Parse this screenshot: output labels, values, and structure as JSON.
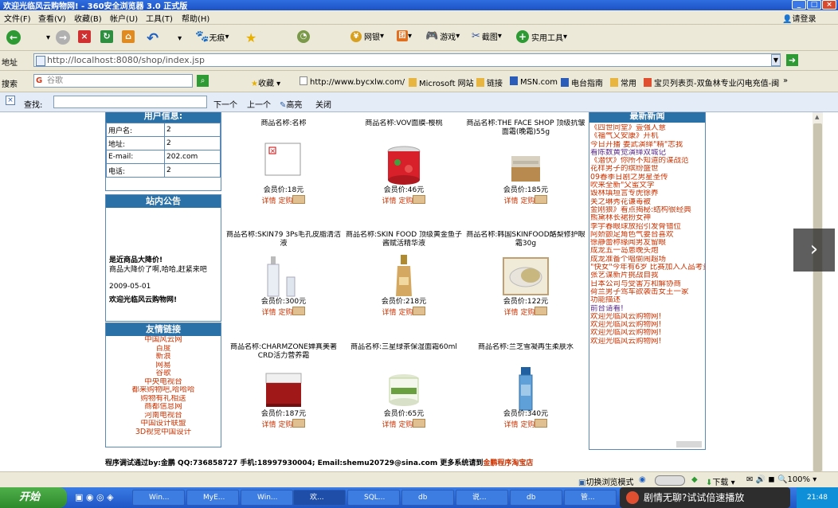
{
  "window": {
    "title": "欢迎光临风云购物网! - 360安全浏览器 3.0 正式版"
  },
  "menu": [
    "文件(F)",
    "查看(V)",
    "收藏(B)",
    "帐户(U)",
    "工具(T)",
    "帮助(H)"
  ],
  "login_label": "请登录",
  "toolbar": {
    "noimage_label": "无痕",
    "netbank_label": "网银",
    "group_label": "团",
    "game_label": "游戏",
    "screenshot_label": "截图",
    "tools_label": "实用工具"
  },
  "address": {
    "label": "地址",
    "url": "http://localhost:8080/shop/index.jsp"
  },
  "search": {
    "label": "搜索",
    "placeholder": "谷歌"
  },
  "favorites": {
    "fav_label": "收藏",
    "items": [
      "http://www.bycxlw.com/",
      "Microsoft 网站",
      "链接",
      "MSN.com",
      "电台指南",
      "常用",
      "宝贝列表页-双鱼林专业闪电充值-闽"
    ]
  },
  "findbar": {
    "label": "查找:",
    "next": "下一个",
    "prev": "上一个",
    "highlight": "高亮",
    "close": "关闭"
  },
  "user_info": {
    "title": "用户信息:",
    "rows": [
      {
        "label": "用户名:",
        "value": "2"
      },
      {
        "label": "地址:",
        "value": "2"
      },
      {
        "label": "E-mail:",
        "value": "202.com"
      },
      {
        "label": "电话:",
        "value": "2"
      }
    ]
  },
  "notice": {
    "title": "站内公告",
    "line1": "是近商品大降价!",
    "line2": "商品大降价了啊,哈哈,赶紧来吧",
    "date": "2009-05-01",
    "line3": "欢迎光临风云购物网!"
  },
  "friend_links": {
    "title": "友情链接",
    "items": [
      "中国风云网",
      "百度",
      "新浪",
      "网易",
      "谷歌",
      "中央电视台",
      "都来购物吧,哈哈哈",
      "购物有礼相送",
      "商都信息网",
      "河南电视台",
      "中国设计联盟",
      "3D视觉中国设计"
    ]
  },
  "products": {
    "price_prefix": "会员价:",
    "detail": "详情",
    "order": "定购",
    "items": [
      {
        "name": "商品名称:名称",
        "price": "18元"
      },
      {
        "name": "商品名称:VOV面膜-樱桃",
        "price": "46元"
      },
      {
        "name": "商品名称:THE FACE SHOP 顶级抗皱面霜(晚霜)55g",
        "price": "185元"
      },
      {
        "name": "商品名称:SKIN79 3Ps毛孔皮脂清洁液",
        "price": "300元"
      },
      {
        "name": "商品名称:SKIN FOOD 顶级黄金鱼子酱赋活精华液",
        "price": "218元"
      },
      {
        "name": "商品名称:韩国SKINFOOD酪梨修护眼霜30g",
        "price": "122元"
      },
      {
        "name": "商品名称:CHARMZONE婵真美著CRD活力营养霜",
        "price": "187元"
      },
      {
        "name": "商品名称:三星绿茶保湿面霜60ml",
        "price": "65元"
      },
      {
        "name": "商品名称:兰芝雪凝再生柔肤水",
        "price": "340元"
      }
    ]
  },
  "news": {
    "title": "最新新闻",
    "items": [
      "《四世同堂》壹强人意",
      "《福气又安康》开机",
      "今日开播 姜武演绎\"精\"志我",
      "看陈数黄觉演绎双城记",
      "《潜伏》你所不知道的谍战范",
      "花样男子的缤纷盛世",
      "09春季日剧之男星圣传",
      "吹来全新\"父蜜文学",
      "毁林填垣言专虎徐养",
      "关之琳秀花谦毒被",
      "金刚狼》看点揭秘:结构很经典",
      "熊黛林长裙扮女神",
      "李宇春眼球放招引发骨错位",
      "阿娇颤足角色气要台喜欢",
      "徐静蕾称缘闻男友留眼",
      "成龙五一岛崽晚头炮",
      "成龙准备个唱偷闹超场",
      "\"快女\"今年有6岁 比赛加入人品考量",
      "张艺谋新片挑战自我",
      "日本公司与受害方和解协商",
      "荷兰男子驾车欲袭击女王一家",
      "功能描述",
      "前台请看!",
      "欢迎光临风云购物网!",
      "欢迎光临风云购物网!",
      "欢迎光临风云购物网!",
      "欢迎光临风云购物网!"
    ]
  },
  "footer": {
    "text": "程序调试通过by:金鹏 QQ:736858727 手机:18997930004; Email:shemu20729@sina.com  更多系统请到",
    "link": "金鹏程序淘宝店"
  },
  "statusbar": {
    "mode": "切换浏览模式",
    "download": "下载",
    "zoom": "100%"
  },
  "taskbar": {
    "start": "开始",
    "tasks": [
      "Win...",
      "MyE...",
      "Win...",
      "欢...",
      "SQL...",
      "db",
      "说...",
      "db",
      "管..."
    ],
    "popup": "剧情无聊?试试倍速播放",
    "clock": "21:48"
  },
  "colors": {
    "panel_head": "#2a71a8",
    "link": "#cc3300",
    "titlebar": "#2f6ee0"
  }
}
